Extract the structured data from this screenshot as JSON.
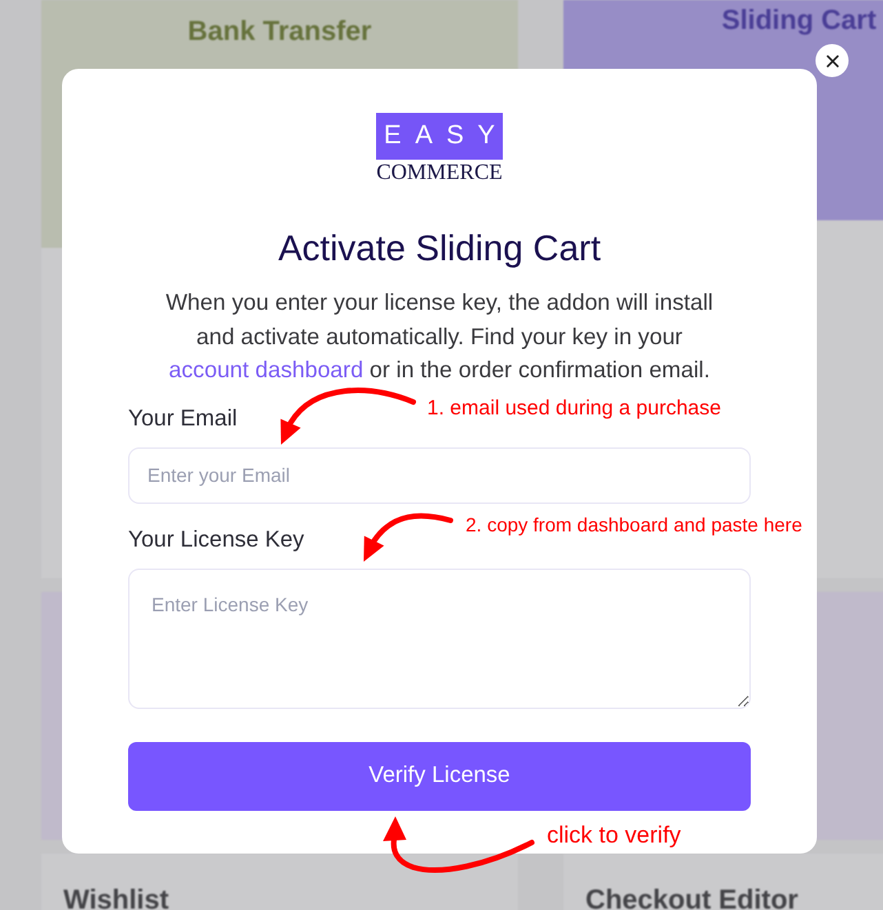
{
  "background_cards": [
    {
      "title": "Bank Transfer"
    },
    {
      "title": "Sliding Cart"
    },
    {
      "title": "Wishlist"
    },
    {
      "title": "Checkout Editor"
    }
  ],
  "dialog": {
    "logo": {
      "badge": "EASY",
      "wordmark": "COMMERCE"
    },
    "title": "Activate Sliding Cart",
    "description": {
      "text_before": "When you enter your license key, the addon will install and activate automatically. Find your key in your",
      "link": "account dashboard",
      "text_after": "or in the order confirmation email."
    },
    "fields": [
      {
        "kind": "input",
        "label": "Your Email",
        "placeholder": "Enter your Email"
      },
      {
        "kind": "textarea",
        "label": "Your License Key",
        "placeholder": "Enter License Key"
      }
    ],
    "button": "Verify License"
  },
  "annotations": [
    {
      "text": "1. email used during a purchase"
    },
    {
      "text": "2. copy from dashboard and paste here"
    },
    {
      "text": "click to verify"
    }
  ]
}
